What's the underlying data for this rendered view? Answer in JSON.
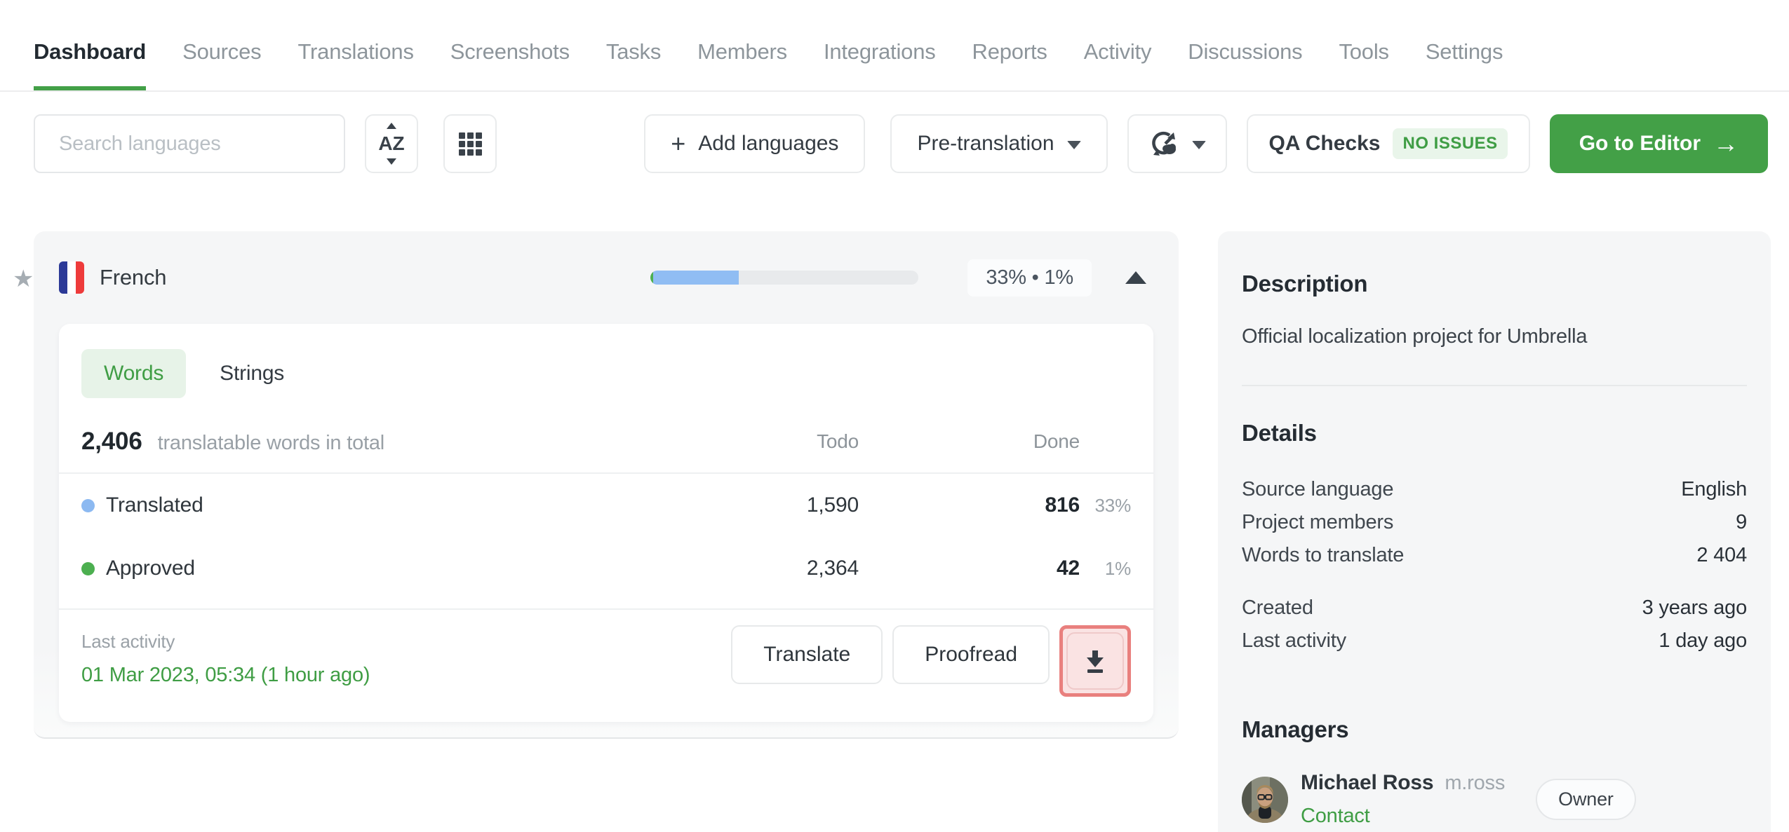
{
  "nav": {
    "items": [
      {
        "label": "Dashboard",
        "active": true
      },
      {
        "label": "Sources",
        "active": false
      },
      {
        "label": "Translations",
        "active": false
      },
      {
        "label": "Screenshots",
        "active": false
      },
      {
        "label": "Tasks",
        "active": false
      },
      {
        "label": "Members",
        "active": false
      },
      {
        "label": "Integrations",
        "active": false
      },
      {
        "label": "Reports",
        "active": false
      },
      {
        "label": "Activity",
        "active": false
      },
      {
        "label": "Discussions",
        "active": false
      },
      {
        "label": "Tools",
        "active": false
      },
      {
        "label": "Settings",
        "active": false
      }
    ]
  },
  "toolbar": {
    "search_placeholder": "Search languages",
    "add_languages_label": "Add languages",
    "pretranslation_label": "Pre-translation",
    "qa_checks_label": "QA Checks",
    "qa_checks_badge": "NO ISSUES",
    "go_to_editor_label": "Go to Editor"
  },
  "language_card": {
    "name": "French",
    "progress_chip": "33% • 1%",
    "progress": {
      "translated_pct": 33,
      "approved_pct": 1
    },
    "tabs": [
      {
        "label": "Words",
        "active": true
      },
      {
        "label": "Strings",
        "active": false
      }
    ],
    "total": {
      "value": "2,406",
      "caption": "translatable words in total"
    },
    "columns": {
      "todo": "Todo",
      "done": "Done"
    },
    "rows": [
      {
        "label": "Translated",
        "todo": "1,590",
        "done": "816",
        "pct": "33%",
        "color": "#8cb9f1"
      },
      {
        "label": "Approved",
        "todo": "2,364",
        "done": "42",
        "pct": "1%",
        "color": "#4caf50"
      }
    ],
    "last_activity": {
      "label": "Last activity",
      "value": "01 Mar 2023, 05:34 (1 hour ago)"
    },
    "actions": {
      "translate": "Translate",
      "proofread": "Proofread"
    }
  },
  "sidebar": {
    "description": {
      "title": "Description",
      "text": "Official localization project for Umbrella"
    },
    "details": {
      "title": "Details",
      "rows": [
        {
          "label": "Source language",
          "value": "English"
        },
        {
          "label": "Project members",
          "value": "9"
        },
        {
          "label": "Words to translate",
          "value": "2 404"
        }
      ],
      "rows2": [
        {
          "label": "Created",
          "value": "3 years ago"
        },
        {
          "label": "Last activity",
          "value": "1 day ago"
        }
      ]
    },
    "managers": {
      "title": "Managers",
      "manager": {
        "name": "Michael Ross",
        "username": "m.ross",
        "contact": "Contact",
        "badge": "Owner"
      }
    }
  },
  "colors": {
    "primary_green": "#43a047",
    "green_text": "#3f9d44",
    "light_green_bg": "#e7f3e8",
    "translated_blue": "#8cb9f1",
    "approved_green": "#4caf50",
    "highlight_red": "#e9807e",
    "highlight_pink_bg": "#fae3e3"
  }
}
